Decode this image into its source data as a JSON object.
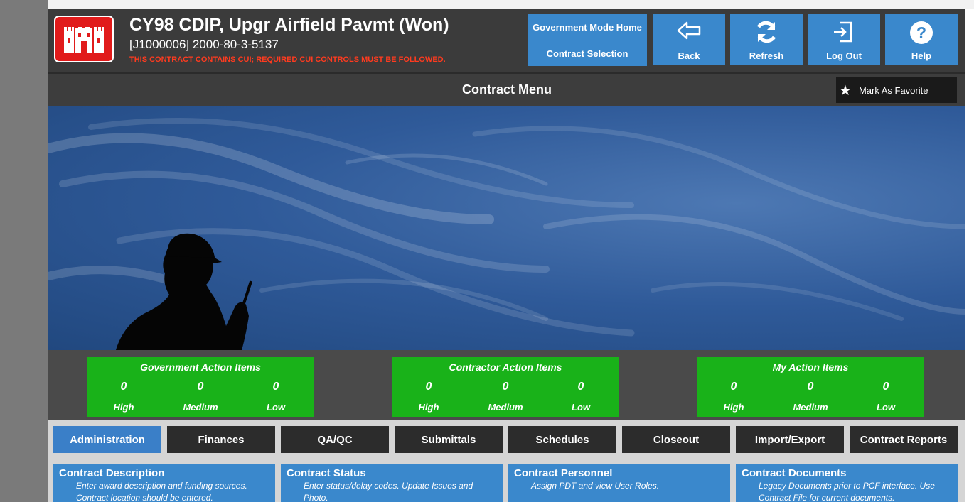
{
  "header": {
    "title": "CY98 CDIP, Upgr Airfield Pavmt (Won)",
    "contract_id": "[J1000006] 2000-80-3-5137",
    "cui_warning": "THIS CONTRACT CONTAINS CUI; REQUIRED CUI CONTROLS MUST BE FOLLOWED.",
    "logo_icon": "castle-icon",
    "buttons": {
      "gov_home": "Government Mode Home",
      "contract_selection": "Contract Selection",
      "back": "Back",
      "refresh": "Refresh",
      "logout": "Log Out",
      "help": "Help"
    }
  },
  "menu": {
    "title": "Contract Menu",
    "favorite_label": "Mark As Favorite"
  },
  "action_items": [
    {
      "title": "Government Action Items",
      "high": "0",
      "medium": "0",
      "low": "0"
    },
    {
      "title": "Contractor Action Items",
      "high": "0",
      "medium": "0",
      "low": "0"
    },
    {
      "title": "My Action Items",
      "high": "0",
      "medium": "0",
      "low": "0"
    }
  ],
  "levels": {
    "high": "High",
    "medium": "Medium",
    "low": "Low"
  },
  "tabs": [
    "Administration",
    "Finances",
    "QA/QC",
    "Submittals",
    "Schedules",
    "Closeout",
    "Import/Export",
    "Contract Reports"
  ],
  "cards": [
    {
      "title": "Contract Description",
      "desc": "Enter award description and funding sources. Contract location should be entered."
    },
    {
      "title": "Contract Status",
      "desc": "Enter status/delay codes. Update Issues and Photo."
    },
    {
      "title": "Contract Personnel",
      "desc": "Assign PDT and view User Roles."
    },
    {
      "title": "Contract Documents",
      "desc": "Legacy Documents prior to PCF interface. Use Contract File for current documents."
    }
  ],
  "colors": {
    "accent_blue": "#3a88cc",
    "action_green": "#19b219",
    "logo_red": "#e11b1b",
    "cui_red": "#ff3b1f"
  }
}
